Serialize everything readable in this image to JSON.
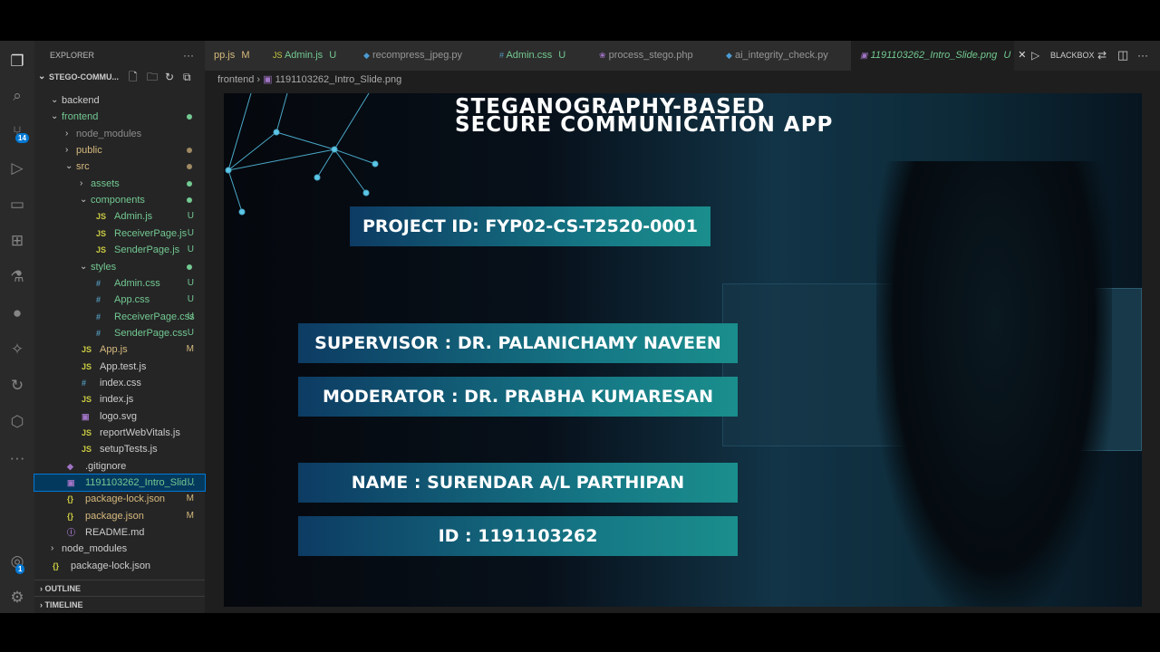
{
  "explorer": {
    "title": "EXPLORER",
    "more": "···",
    "root": "STEGO-COMMU..."
  },
  "tree": [
    {
      "label": "backend",
      "depth": 0,
      "type": "folder",
      "open": true,
      "color": "#cccccc"
    },
    {
      "label": "frontend",
      "depth": 0,
      "type": "folder",
      "open": true,
      "color": "#73c991",
      "dot": "#73c991"
    },
    {
      "label": "node_modules",
      "depth": 1,
      "type": "folder",
      "open": false,
      "color": "#8c8c8c"
    },
    {
      "label": "public",
      "depth": 1,
      "type": "folder",
      "open": false,
      "color": "#d7ba7d",
      "dot": "#a08a63"
    },
    {
      "label": "src",
      "depth": 1,
      "type": "folder",
      "open": true,
      "color": "#d7ba7d",
      "dot": "#a08a63"
    },
    {
      "label": "assets",
      "depth": 2,
      "type": "folder",
      "open": false,
      "color": "#73c991",
      "dot": "#73c991"
    },
    {
      "label": "components",
      "depth": 2,
      "type": "folder",
      "open": true,
      "color": "#73c991",
      "dot": "#73c991"
    },
    {
      "label": "Admin.js",
      "depth": 3,
      "icon": "JS",
      "color": "#73c991",
      "status": "U"
    },
    {
      "label": "ReceiverPage.js",
      "depth": 3,
      "icon": "JS",
      "color": "#73c991",
      "status": "U"
    },
    {
      "label": "SenderPage.js",
      "depth": 3,
      "icon": "JS",
      "color": "#73c991",
      "status": "U"
    },
    {
      "label": "styles",
      "depth": 2,
      "type": "folder",
      "open": true,
      "color": "#73c991",
      "dot": "#73c991"
    },
    {
      "label": "Admin.css",
      "depth": 3,
      "icon": "#",
      "color": "#73c991",
      "status": "U"
    },
    {
      "label": "App.css",
      "depth": 3,
      "icon": "#",
      "color": "#73c991",
      "status": "U"
    },
    {
      "label": "ReceiverPage.css",
      "depth": 3,
      "icon": "#",
      "color": "#73c991",
      "status": "U"
    },
    {
      "label": "SenderPage.css",
      "depth": 3,
      "icon": "#",
      "color": "#73c991",
      "status": "U"
    },
    {
      "label": "App.js",
      "depth": 2,
      "icon": "JS",
      "color": "#d7ba7d",
      "status": "M"
    },
    {
      "label": "App.test.js",
      "depth": 2,
      "icon": "JS",
      "color": "#cccccc"
    },
    {
      "label": "index.css",
      "depth": 2,
      "icon": "#",
      "color": "#cccccc"
    },
    {
      "label": "index.js",
      "depth": 2,
      "icon": "JS",
      "color": "#cccccc"
    },
    {
      "label": "logo.svg",
      "depth": 2,
      "icon": "▣",
      "color": "#cccccc"
    },
    {
      "label": "reportWebVitals.js",
      "depth": 2,
      "icon": "JS",
      "color": "#cccccc"
    },
    {
      "label": "setupTests.js",
      "depth": 2,
      "icon": "JS",
      "color": "#cccccc"
    },
    {
      "label": ".gitignore",
      "depth": 1,
      "icon": "◆",
      "color": "#cccccc"
    },
    {
      "label": "1191103262_Intro_Slid...",
      "depth": 1,
      "icon": "▣",
      "color": "#73c991",
      "status": "U",
      "selected": true
    },
    {
      "label": "package-lock.json",
      "depth": 1,
      "icon": "{}",
      "color": "#d7ba7d",
      "status": "M"
    },
    {
      "label": "package.json",
      "depth": 1,
      "icon": "{}",
      "color": "#d7ba7d",
      "status": "M"
    },
    {
      "label": "README.md",
      "depth": 1,
      "icon": "ⓘ",
      "color": "#cccccc"
    },
    {
      "label": "node_modules",
      "depth": 0,
      "type": "folder",
      "open": false,
      "color": "#cccccc"
    },
    {
      "label": "package-lock.json",
      "depth": 0,
      "icon": "{}",
      "color": "#cccccc"
    }
  ],
  "panels": {
    "outline": "OUTLINE",
    "timeline": "TIMELINE"
  },
  "activity": {
    "scm_badge": "14",
    "account_badge": "1"
  },
  "tabs": [
    {
      "label": "pp.js",
      "status": "M",
      "icon": "",
      "color": "#d7ba7d"
    },
    {
      "label": "Admin.js",
      "status": "U",
      "icon": "JS",
      "color": "#73c991"
    },
    {
      "label": "recompress_jpeg.py",
      "status": "",
      "icon": "◆",
      "color": "#969696"
    },
    {
      "label": "Admin.css",
      "status": "U",
      "icon": "#",
      "color": "#73c991"
    },
    {
      "label": "process_stego.php",
      "status": "",
      "icon": "❀",
      "color": "#969696"
    },
    {
      "label": "ai_integrity_check.py",
      "status": "",
      "icon": "◆",
      "color": "#969696"
    },
    {
      "label": "1191103262_Intro_Slide.png",
      "status": "U",
      "icon": "▣",
      "color": "#73c991",
      "active": true
    }
  ],
  "toolbar": {
    "blackbox": "BLACKBOX",
    "more": "···"
  },
  "breadcrumb": {
    "folder": "frontend",
    "file": "1191103262_Intro_Slide.png"
  },
  "slide": {
    "title1": "STEGANOGRAPHY-BASED",
    "title2": "SECURE COMMUNICATION APP",
    "project": "PROJECT ID: FYP02-CS-T2520-0001",
    "supervisor": "SUPERVISOR : DR. PALANICHAMY NAVEEN",
    "moderator": "MODERATOR : DR. PRABHA KUMARESAN",
    "name": "NAME : SURENDAR A/L PARTHIPAN",
    "id": "ID : 1191103262"
  }
}
